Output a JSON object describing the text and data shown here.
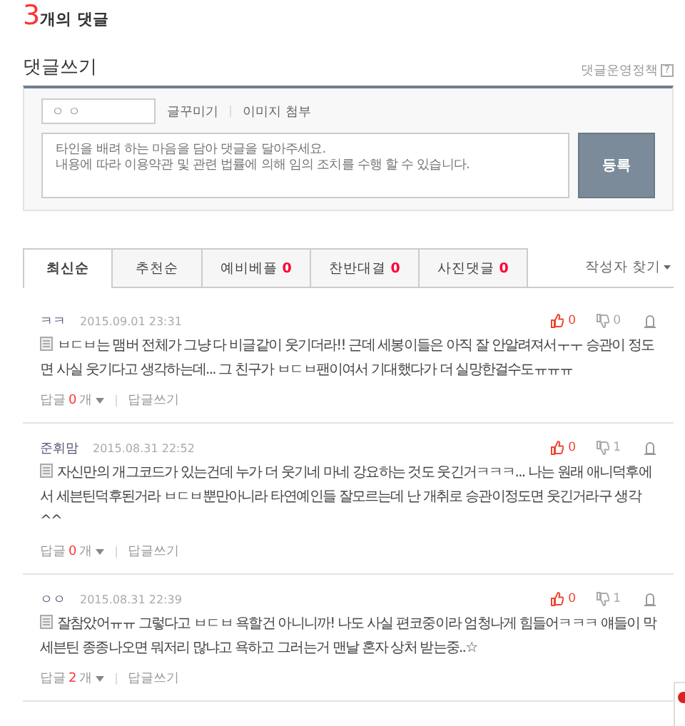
{
  "comment_count": {
    "number": "3",
    "label": "개의 댓글"
  },
  "write": {
    "title": "댓글쓰기",
    "policy_link": "댓글운영정책",
    "policy_help": "?",
    "nickname": "ㅇ ㅇ",
    "tools": [
      "글꾸미기",
      "이미지 첨부"
    ],
    "placeholder": "타인을 배려 하는 마음을 담아 댓글을 달아주세요.\n내용에 따라 이용약관 및 관련 법률에 의해 임의 조치를 수행 할 수 있습니다.",
    "submit": "등록"
  },
  "tabs": [
    {
      "label": "최신순",
      "selected": true
    },
    {
      "label": "추천순",
      "selected": false
    },
    {
      "label": "예비베플",
      "count": "0",
      "selected": false
    },
    {
      "label": "찬반대결",
      "count": "0",
      "selected": false
    },
    {
      "label": "사진댓글",
      "count": "0",
      "selected": false
    }
  ],
  "author_filter": "작성자 찾기",
  "comments": [
    {
      "author": "ㅋㅋ",
      "date": "2015.09.01 23:31",
      "likes": "0",
      "dislikes": "0",
      "text": "ㅂㄷㅂ는 맴버 전체가 그냥 다 비글같이 웃기더라!! 근데 세봉이들은 아직 잘 안알려져서ㅜㅜ 승관이 정도면 사실 웃기다고 생각하는데... 그 친구가 ㅂㄷㅂ팬이여서 기대했다가 더 실망한걸수도ㅠㅠㅠ",
      "reply_label": "답글",
      "reply_count": "0",
      "reply_unit": "개",
      "write_reply": "답글쓰기"
    },
    {
      "author": "준휘맘",
      "date": "2015.08.31 22:52",
      "likes": "0",
      "dislikes": "1",
      "text": "자신만의 개그코드가 있는건데 누가 더 웃기네 마네 강요하는 것도 웃긴거ㅋㅋㅋ... 나는 원래 애니덕후에서 세븐틴덕후된거라 ㅂㄷㅂ뿐만아니라 타연예인들 잘모르는데 난 개취로 승관이정도면 웃긴거라구 생각^^",
      "reply_label": "답글",
      "reply_count": "0",
      "reply_unit": "개",
      "write_reply": "답글쓰기"
    },
    {
      "author": "ㅇㅇ",
      "date": "2015.08.31 22:39",
      "likes": "0",
      "dislikes": "1",
      "text": "잘참았어ㅠㅠ 그렇다고 ㅂㄷㅂ 욕할건 아니니까! 나도 사실 편코중이라 엄청나게 힘들어ㅋㅋㅋ 얘들이 막 세븐틴 종종나오면 뭐저리 많냐고 욕하고 그러는거 맨날 혼자 상처 받는중..☆",
      "reply_label": "답글",
      "reply_count": "2",
      "reply_unit": "개",
      "write_reply": "답글쓰기"
    }
  ]
}
